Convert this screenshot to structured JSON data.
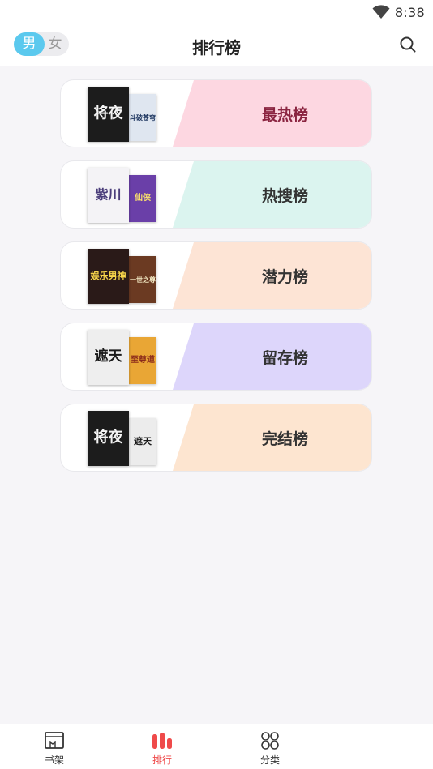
{
  "status_bar": {
    "time": "8:38",
    "wifi_icon": "wifi-icon"
  },
  "header": {
    "title": "排行榜",
    "gender": {
      "male": "男",
      "female": "女",
      "selected": "男"
    },
    "search_icon": "search-icon"
  },
  "rank_boards": [
    {
      "label": "最热榜",
      "bg": "#fdd7e1",
      "text_color": "#8a2440",
      "covers": {
        "front_text": "将夜",
        "back_text": "斗破苍穹",
        "front_bg": "#1c1c1c",
        "back_bg": "#dfe6f0"
      }
    },
    {
      "label": "热搜榜",
      "bg": "#dbf4ef",
      "text_color": "#333333",
      "covers": {
        "front_text": "紫川",
        "back_text": "仙侠",
        "front_bg": "#f4f3f6",
        "back_bg": "#6a3fa8"
      }
    },
    {
      "label": "潜力榜",
      "bg": "#fde4d5",
      "text_color": "#333333",
      "covers": {
        "front_text": "娱乐男神",
        "back_text": "一世之尊",
        "front_bg": "#2a1a18",
        "back_bg": "#6b3a22"
      }
    },
    {
      "label": "留存榜",
      "bg": "#ddd6fb",
      "text_color": "#333333",
      "covers": {
        "front_text": "遮天",
        "back_text": "至尊道",
        "front_bg": "#eeeeee",
        "back_bg": "#e9a635"
      }
    },
    {
      "label": "完结榜",
      "bg": "#fde5d0",
      "text_color": "#333333",
      "covers": {
        "front_text": "将夜",
        "back_text": "遮天",
        "front_bg": "#1c1c1c",
        "back_bg": "#ececec"
      }
    }
  ],
  "tab_bar": {
    "tabs": [
      {
        "label": "书架",
        "icon": "bookshelf-icon"
      },
      {
        "label": "排行",
        "icon": "ranking-icon"
      },
      {
        "label": "分类",
        "icon": "category-icon"
      }
    ],
    "active": "排行",
    "accent": "#ef4a4a"
  }
}
